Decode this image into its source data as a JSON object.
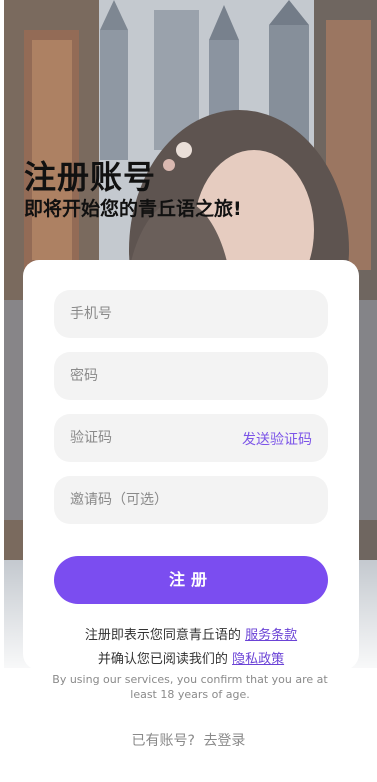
{
  "header": {
    "title": "注册账号",
    "subtitle": "即将开始您的青丘语之旅!"
  },
  "form": {
    "phone_placeholder": "手机号",
    "password_placeholder": "密码",
    "code_placeholder": "验证码",
    "send_code_label": "发送验证码",
    "invite_placeholder": "邀请码（可选）",
    "submit_label": "注册"
  },
  "agreement": {
    "line1_prefix": "注册即表示您同意青丘语的",
    "terms_link": "服务条款",
    "line2_prefix": "并确认您已阅读我们的",
    "privacy_link": "隐私政策",
    "age_notice": "By using our services, you confirm that you are at least 18 years of age."
  },
  "footer": {
    "has_account": "已有账号?",
    "login_link": "去登录"
  },
  "colors": {
    "accent": "#7b4df0",
    "link": "#6b43d6",
    "field_bg": "#f3f3f3"
  }
}
